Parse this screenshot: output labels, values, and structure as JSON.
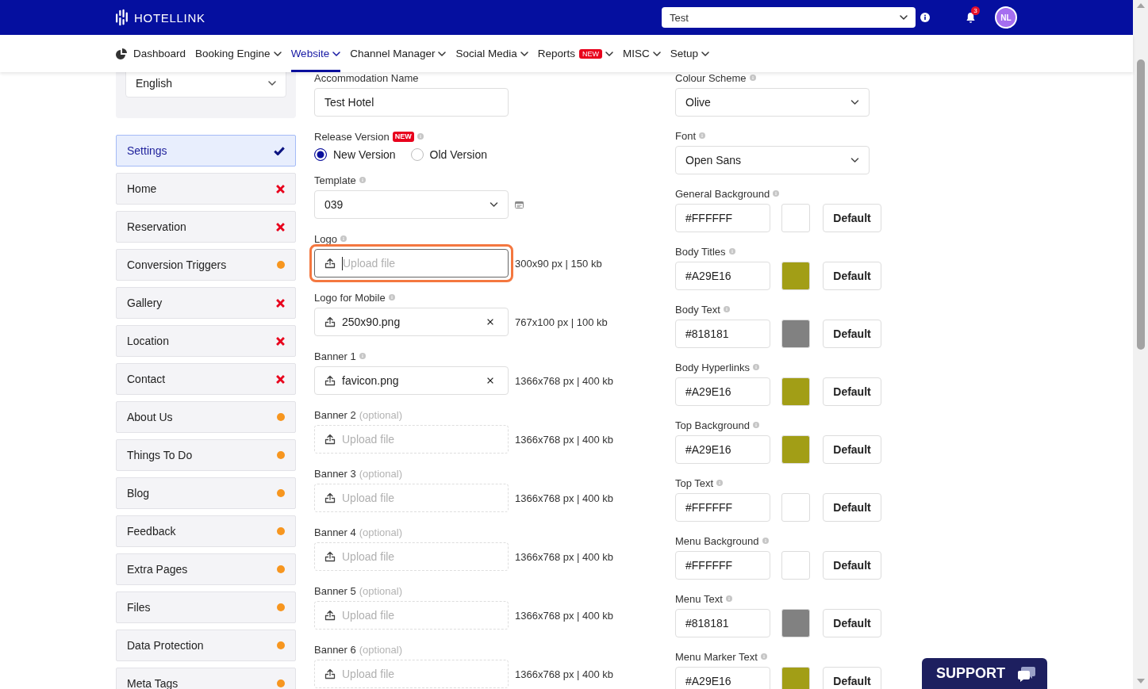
{
  "header": {
    "brand": "HOTELLINK",
    "property_select": {
      "value": "Test"
    },
    "notifications": {
      "count": "3"
    },
    "avatar": {
      "initials": "NL"
    }
  },
  "nav": [
    {
      "label": "Dashboard",
      "kind": "dashboard",
      "selected": false
    },
    {
      "label": "Booking Engine",
      "kind": "menu",
      "selected": false
    },
    {
      "label": "Website",
      "kind": "menu",
      "selected": true
    },
    {
      "label": "Channel Manager",
      "kind": "menu",
      "selected": false
    },
    {
      "label": "Social Media",
      "kind": "menu",
      "selected": false
    },
    {
      "label": "Reports",
      "kind": "menu",
      "selected": false,
      "badge": "NEW"
    },
    {
      "label": "MISC",
      "kind": "menu",
      "selected": false
    },
    {
      "label": "Setup",
      "kind": "menu",
      "selected": false
    }
  ],
  "sidebar": {
    "language": {
      "value": "English"
    },
    "items": [
      {
        "label": "Settings",
        "kind": "complete",
        "selected": true
      },
      {
        "label": "Home",
        "kind": "missing",
        "selected": false
      },
      {
        "label": "Reservation",
        "kind": "missing",
        "selected": false
      },
      {
        "label": "Conversion Triggers",
        "kind": "partial",
        "selected": false
      },
      {
        "label": "Gallery",
        "kind": "missing",
        "selected": false
      },
      {
        "label": "Location",
        "kind": "missing",
        "selected": false
      },
      {
        "label": "Contact",
        "kind": "missing",
        "selected": false
      },
      {
        "label": "About Us",
        "kind": "partial",
        "selected": false
      },
      {
        "label": "Things To Do",
        "kind": "partial",
        "selected": false
      },
      {
        "label": "Blog",
        "kind": "partial",
        "selected": false
      },
      {
        "label": "Feedback",
        "kind": "partial",
        "selected": false
      },
      {
        "label": "Extra Pages",
        "kind": "partial",
        "selected": false
      },
      {
        "label": "Files",
        "kind": "partial",
        "selected": false
      },
      {
        "label": "Data Protection",
        "kind": "partial",
        "selected": false
      },
      {
        "label": "Meta Tags",
        "kind": "partial",
        "selected": false
      }
    ]
  },
  "general": {
    "fields": [
      {
        "kind": "text",
        "label": "Accommodation Name",
        "info": false,
        "value": "Test Hotel"
      },
      {
        "kind": "radio",
        "label": "Release Version",
        "badge": "NEW",
        "info": true,
        "options": [
          {
            "label": "New Version",
            "selected": true
          },
          {
            "label": "Old Version",
            "selected": false
          }
        ]
      },
      {
        "kind": "select",
        "label": "Template",
        "info": true,
        "value": "039",
        "preview": true
      },
      {
        "kind": "upload",
        "label": "Logo",
        "info": true,
        "optional": false,
        "focused": true,
        "placeholder": "Upload file",
        "hint": "300x90 px | 150 kb"
      },
      {
        "kind": "upload",
        "label": "Logo for Mobile",
        "info": true,
        "optional": false,
        "focused": false,
        "value": "250x90.png",
        "hint": "767x100 px | 100 kb"
      },
      {
        "kind": "upload",
        "label": "Banner 1",
        "info": true,
        "optional": false,
        "focused": false,
        "value": "favicon.png",
        "hint": "1366x768 px | 400 kb"
      },
      {
        "kind": "upload",
        "label": "Banner 2",
        "note": "(optional)",
        "info": false,
        "optional": true,
        "focused": false,
        "placeholder": "Upload file",
        "hint": "1366x768 px | 400 kb"
      },
      {
        "kind": "upload",
        "label": "Banner 3",
        "note": "(optional)",
        "info": false,
        "optional": true,
        "focused": false,
        "placeholder": "Upload file",
        "hint": "1366x768 px | 400 kb"
      },
      {
        "kind": "upload",
        "label": "Banner 4",
        "note": "(optional)",
        "info": false,
        "optional": true,
        "focused": false,
        "placeholder": "Upload file",
        "hint": "1366x768 px | 400 kb"
      },
      {
        "kind": "upload",
        "label": "Banner 5",
        "note": "(optional)",
        "info": false,
        "optional": true,
        "focused": false,
        "placeholder": "Upload file",
        "hint": "1366x768 px | 400 kb"
      },
      {
        "kind": "upload",
        "label": "Banner 6",
        "note": "(optional)",
        "info": false,
        "optional": true,
        "focused": false,
        "placeholder": "Upload file",
        "hint": "1366x768 px | 400 kb"
      }
    ]
  },
  "appearance": {
    "fields": [
      {
        "kind": "select",
        "label": "Colour Scheme",
        "info": true,
        "value": "Olive"
      },
      {
        "kind": "select",
        "label": "Font",
        "info": true,
        "value": "Open Sans"
      },
      {
        "kind": "color",
        "label": "General Background",
        "info": true,
        "value": "#FFFFFF",
        "color": "#ffffff",
        "button": "Default"
      },
      {
        "kind": "color",
        "label": "Body Titles",
        "info": true,
        "value": "#A29E16",
        "color": "#a29e16",
        "button": "Default"
      },
      {
        "kind": "color",
        "label": "Body Text",
        "info": true,
        "value": "#818181",
        "color": "#818181",
        "button": "Default"
      },
      {
        "kind": "color",
        "label": "Body Hyperlinks",
        "info": true,
        "value": "#A29E16",
        "color": "#a29e16",
        "button": "Default"
      },
      {
        "kind": "color",
        "label": "Top Background",
        "info": true,
        "value": "#A29E16",
        "color": "#a29e16",
        "button": "Default"
      },
      {
        "kind": "color",
        "label": "Top Text",
        "info": true,
        "value": "#FFFFFF",
        "color": "#ffffff",
        "button": "Default"
      },
      {
        "kind": "color",
        "label": "Menu Background",
        "info": true,
        "value": "#FFFFFF",
        "color": "#ffffff",
        "button": "Default"
      },
      {
        "kind": "color",
        "label": "Menu Text",
        "info": true,
        "value": "#818181",
        "color": "#818181",
        "button": "Default"
      },
      {
        "kind": "color",
        "label": "Menu Marker Text",
        "info": true,
        "value": "#A29E16",
        "color": "#a29e16",
        "button": "Default"
      }
    ]
  },
  "support_button": {
    "label": "SUPPORT"
  }
}
